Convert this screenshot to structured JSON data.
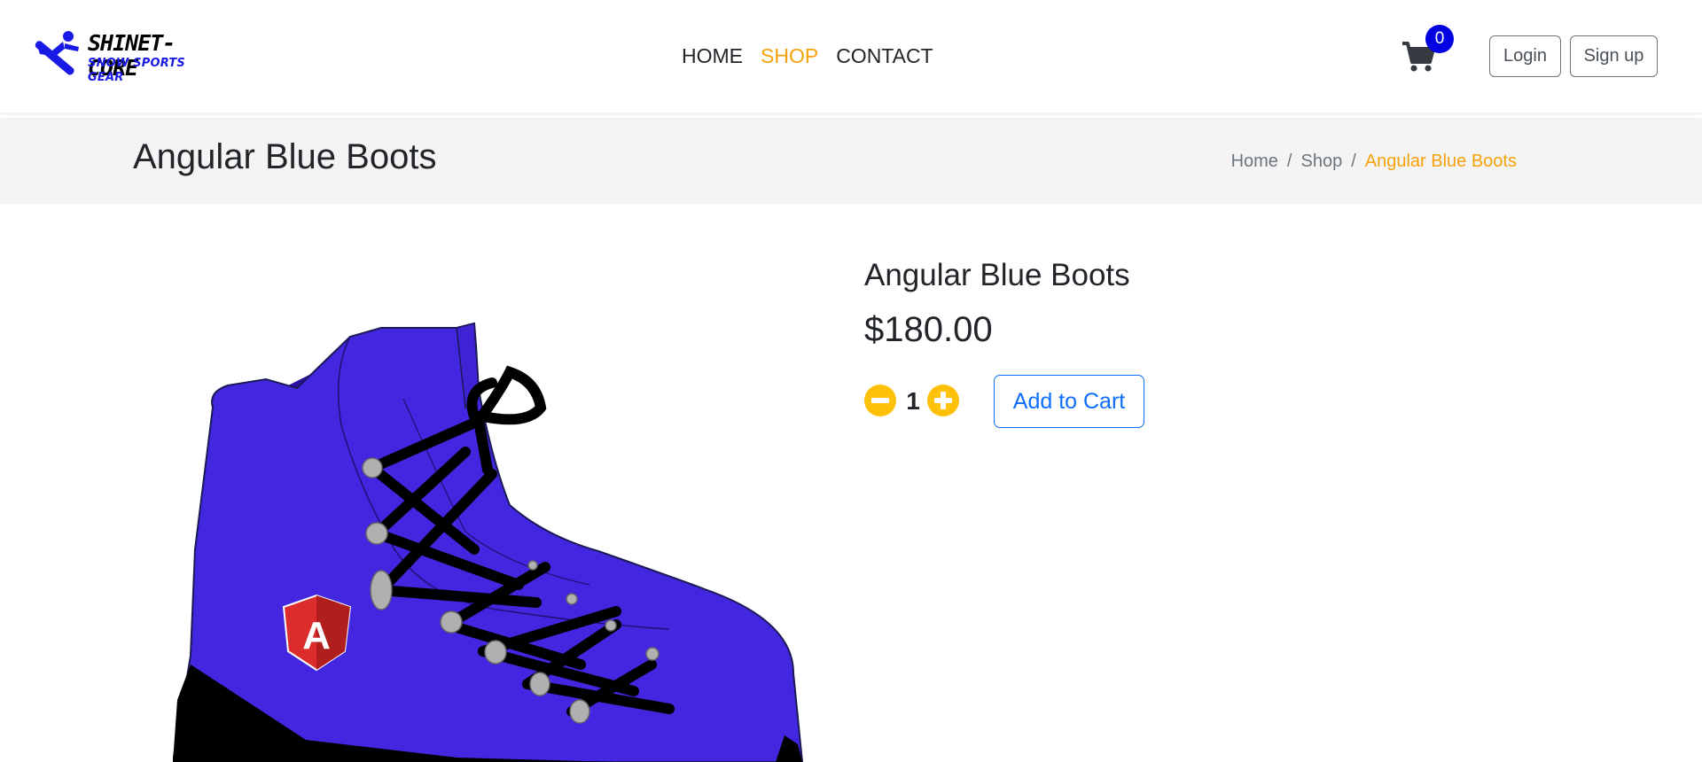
{
  "brand": {
    "name": "SHINET-CORE",
    "tagline": "SNOW SPORTS GEAR",
    "accent": "#1a1ae6"
  },
  "nav": {
    "items": [
      {
        "label": "HOME",
        "active": false
      },
      {
        "label": "SHOP",
        "active": true
      },
      {
        "label": "CONTACT",
        "active": false
      }
    ]
  },
  "cart": {
    "icon": "shopping-cart-icon",
    "count": "0"
  },
  "auth": {
    "login_label": "Login",
    "signup_label": "Sign up"
  },
  "page": {
    "title": "Angular Blue Boots",
    "breadcrumb": [
      "Home",
      "Shop",
      "Angular Blue Boots"
    ]
  },
  "product": {
    "name": "Angular Blue Boots",
    "price": "$180.00",
    "quantity": "1",
    "add_to_cart_label": "Add to Cart",
    "image_logo_letter": "A"
  },
  "colors": {
    "accent_orange": "#f5a20a",
    "primary_blue": "#0d6efd",
    "badge_blue": "#0000e0",
    "qty_yellow": "#ffc107",
    "boot_blue": "#4326e0"
  }
}
